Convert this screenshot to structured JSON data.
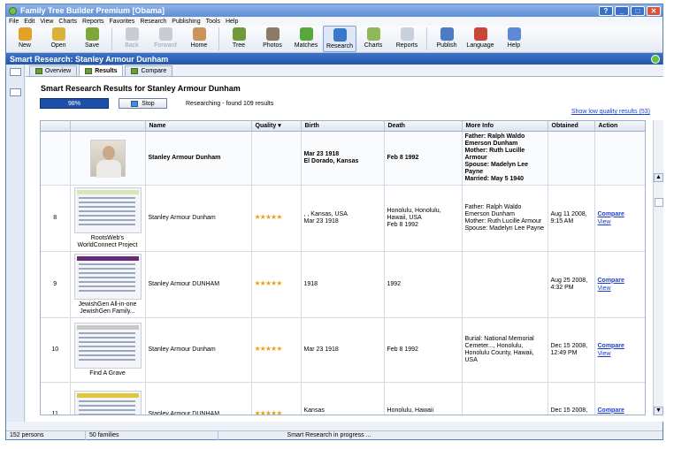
{
  "window": {
    "title": "Family Tree Builder Premium [Obama]",
    "buttons": [
      "?",
      "_",
      "□",
      "✕"
    ]
  },
  "menu": [
    "File",
    "Edit",
    "View",
    "Charts",
    "Reports",
    "Favorites",
    "Research",
    "Publishing",
    "Tools",
    "Help"
  ],
  "toolbar": [
    {
      "label": "New",
      "icon": "new-icon",
      "color": "#e0a326",
      "disabled": false
    },
    {
      "label": "Open",
      "icon": "open-icon",
      "color": "#d9b23a",
      "disabled": false
    },
    {
      "label": "Save",
      "icon": "save-icon",
      "color": "#7fa63a",
      "disabled": false
    },
    {
      "label": "Back",
      "icon": "back-icon",
      "color": "#c8ccd4",
      "disabled": true
    },
    {
      "label": "Forward",
      "icon": "forward-icon",
      "color": "#c8ccd4",
      "disabled": true
    },
    {
      "label": "Home",
      "icon": "home-icon",
      "color": "#c9955a",
      "disabled": false
    },
    {
      "label": "Tree",
      "icon": "tree-icon",
      "color": "#6f9a3a",
      "disabled": false
    },
    {
      "label": "Photos",
      "icon": "photos-icon",
      "color": "#8a7a66",
      "disabled": false
    },
    {
      "label": "Matches",
      "icon": "matches-icon",
      "color": "#56a83a",
      "disabled": false
    },
    {
      "label": "Research",
      "icon": "research-icon",
      "color": "#3a78c9",
      "disabled": false,
      "active": true
    },
    {
      "label": "Charts",
      "icon": "charts-icon",
      "color": "#8fb85a",
      "disabled": false
    },
    {
      "label": "Reports",
      "icon": "reports-icon",
      "color": "#c8d0dc",
      "disabled": false
    },
    {
      "label": "Publish",
      "icon": "publish-icon",
      "color": "#4a7bc4",
      "disabled": false
    },
    {
      "label": "Language",
      "icon": "language-icon",
      "color": "#c9463a",
      "disabled": false
    },
    {
      "label": "Help",
      "icon": "help-icon",
      "color": "#5a8ad8",
      "disabled": false
    }
  ],
  "page_title": "Smart Research: Stanley Armour Dunham",
  "tabs": [
    {
      "label": "Overview",
      "active": false
    },
    {
      "label": "Results",
      "active": true
    },
    {
      "label": "Compare",
      "active": false
    }
  ],
  "results": {
    "heading": "Smart Research Results for Stanley Armour Dunham",
    "progress_text": "98%",
    "progress_value": 0.98,
    "stop_label": "Stop",
    "status": "Researching - found 109 results",
    "low_quality_link": "Show low quality results (53)"
  },
  "columns": [
    "",
    "",
    "Name",
    "Quality",
    "Birth",
    "Death",
    "More Info",
    "Obtained",
    "Action"
  ],
  "master": {
    "name": "Stanley Armour Dunham",
    "birth": "Mar 23 1918\nEl Dorado, Kansas",
    "death": "Feb 8 1992",
    "more_info": "Father: Ralph Waldo Emerson Dunham\nMother: Ruth Lucille Armour\nSpouse: Madelyn Lee Payne\nMarried: May 5 1940"
  },
  "rows": [
    {
      "num": "8",
      "source": "RootsWeb's WorldConnect Project",
      "name": "Stanley Armour Dunham",
      "stars": "★★★★★",
      "birth": ", , Kansas, USA\nMar 23 1918",
      "death": "Honolulu, Honolulu, Hawaii, USA\nFeb 8 1992",
      "more_info": "Father: Ralph Waldo Emerson Dunham\nMother: Ruth Lucille Armour\nSpouse: Madelyn Lee Payne",
      "obtained": "Aug 11 2008, 9:15 AM",
      "compare": "Compare",
      "view": "View",
      "thumb_color": "#d9e6b8"
    },
    {
      "num": "9",
      "source": "JewishGen All-in-one JewishGen Family...",
      "name": "Stanley Armour DUNHAM",
      "stars": "★★★★★",
      "birth": "1918",
      "death": "1992",
      "more_info": "",
      "obtained": "Aug 25 2008, 4:32 PM",
      "compare": "Compare",
      "view": "View",
      "thumb_color": "#6a2a78"
    },
    {
      "num": "10",
      "source": "Find A Grave",
      "name": "Stanley Armour Dunham",
      "stars": "★★★★★",
      "birth": "Mar 23 1918",
      "death": "Feb 8 1992",
      "more_info": "Burial: National Memorial Cemeter..., Honolulu, Honolulu County, Hawaii, USA",
      "obtained": "Dec 15 2008, 12:49 PM",
      "compare": "Compare",
      "view": "View",
      "thumb_color": "#c7c7c7"
    },
    {
      "num": "11",
      "source": "",
      "name": "Stanley Armour DUNHAM",
      "stars": "★★★★★",
      "birth": "Kansas\n1918",
      "death": "Honolulu, Hawaii\n1992",
      "more_info": "",
      "obtained": "Dec 15 2008, 12:54 PM",
      "compare": "Compare",
      "view": "View",
      "thumb_color": "#e2c63a"
    }
  ],
  "statusbar": {
    "persons": "152 persons",
    "families": "50 families",
    "message": "Smart Research in progress ..."
  }
}
